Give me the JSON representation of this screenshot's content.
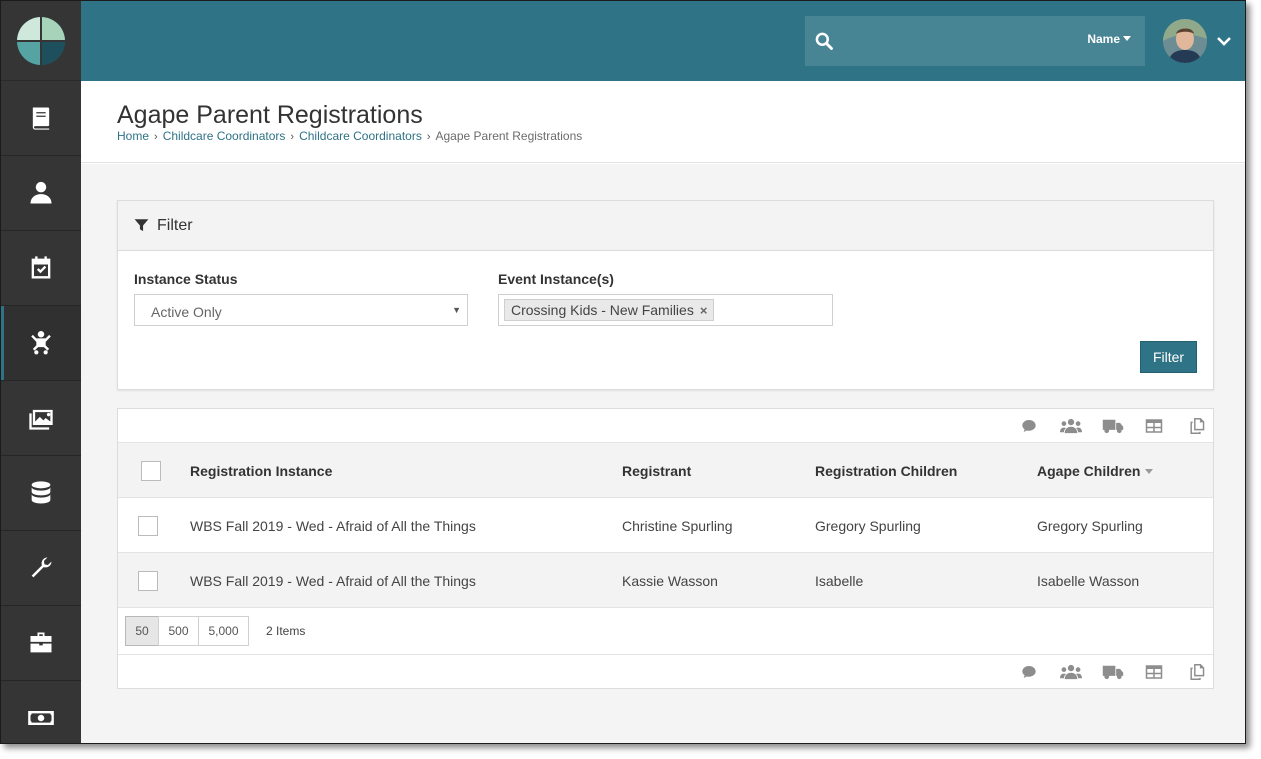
{
  "header": {
    "search_filter_label": "Name"
  },
  "sidebar": {
    "items": [
      {
        "icon": "book-icon"
      },
      {
        "icon": "person-icon"
      },
      {
        "icon": "calendar-check-icon"
      },
      {
        "icon": "child-icon",
        "active": true
      },
      {
        "icon": "images-icon"
      },
      {
        "icon": "database-icon"
      },
      {
        "icon": "wrench-icon"
      },
      {
        "icon": "briefcase-icon"
      },
      {
        "icon": "money-icon"
      }
    ]
  },
  "page": {
    "title": "Agape Parent Registrations",
    "breadcrumb": [
      "Home",
      "Childcare Coordinators",
      "Childcare Coordinators",
      "Agape Parent Registrations"
    ]
  },
  "filter": {
    "heading": "Filter",
    "instance_status_label": "Instance Status",
    "instance_status_value": "Active Only",
    "event_instances_label": "Event Instance(s)",
    "event_instances_chip": "Crossing Kids - New Families",
    "button_label": "Filter"
  },
  "grid": {
    "columns": [
      "Registration Instance",
      "Registrant",
      "Registration Children",
      "Agape Children"
    ],
    "rows": [
      {
        "instance": "WBS Fall 2019 - Wed - Afraid of All the Things",
        "registrant": "Christine Spurling",
        "reg_children": "Gregory Spurling",
        "agape_children": "Gregory Spurling"
      },
      {
        "instance": "WBS Fall 2019 - Wed - Afraid of All the Things",
        "registrant": "Kassie Wasson",
        "reg_children": "Isabelle",
        "agape_children": "Isabelle Wasson"
      }
    ],
    "page_sizes": [
      "50",
      "500",
      "5,000"
    ],
    "item_count": "2 Items",
    "action_icons": [
      "comment-icon",
      "users-icon",
      "truck-icon",
      "table-icon",
      "copy-icon"
    ]
  },
  "colors": {
    "brand": "#2e7386",
    "sidebar": "#353535"
  }
}
